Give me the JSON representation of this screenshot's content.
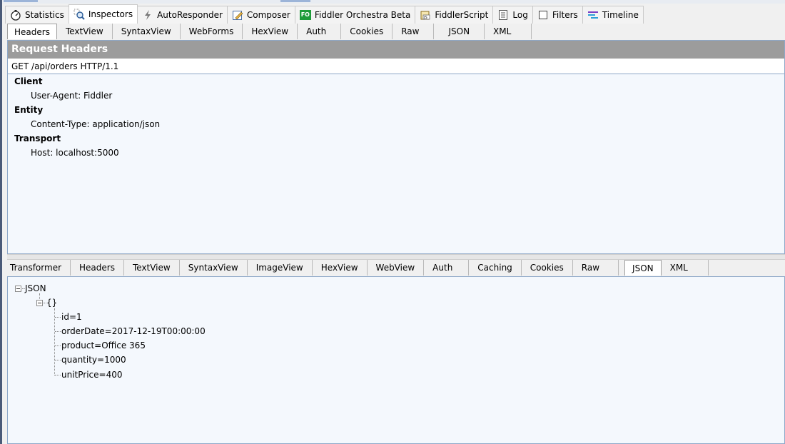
{
  "main_tabs": [
    {
      "label": "Statistics",
      "icon": "stopwatch-icon",
      "active": false
    },
    {
      "label": "Inspectors",
      "icon": "magnifier-icon",
      "active": true
    },
    {
      "label": "AutoResponder",
      "icon": "lightning-icon",
      "active": false
    },
    {
      "label": "Composer",
      "icon": "pencil-icon",
      "active": false
    },
    {
      "label": "Fiddler Orchestra Beta",
      "icon": "fo-icon",
      "badge": "FO",
      "active": false
    },
    {
      "label": "FiddlerScript",
      "icon": "script-icon",
      "active": false
    },
    {
      "label": "Log",
      "icon": "log-icon",
      "active": false
    },
    {
      "label": "Filters",
      "icon": "checkbox-icon",
      "active": false
    },
    {
      "label": "Timeline",
      "icon": "timeline-icon",
      "active": false
    }
  ],
  "request": {
    "subtabs": [
      "Headers",
      "TextView",
      "SyntaxView",
      "WebForms",
      "HexView",
      "Auth",
      "Cookies",
      "Raw",
      "JSON",
      "XML"
    ],
    "active_subtab": "Headers",
    "title": "Request Headers",
    "request_line": "GET /api/orders HTTP/1.1",
    "groups": [
      {
        "name": "Client",
        "items": [
          "User-Agent: Fiddler"
        ]
      },
      {
        "name": "Entity",
        "items": [
          "Content-Type: application/json"
        ]
      },
      {
        "name": "Transport",
        "items": [
          "Host: localhost:5000"
        ]
      }
    ]
  },
  "response": {
    "subtabs": [
      "Transformer",
      "Headers",
      "TextView",
      "SyntaxView",
      "ImageView",
      "HexView",
      "WebView",
      "Auth",
      "Caching",
      "Cookies",
      "Raw",
      "JSON",
      "XML"
    ],
    "active_subtab": "JSON",
    "tree": {
      "root": "JSON",
      "object": "{}",
      "fields": [
        "id=1",
        "orderDate=2017-12-19T00:00:00",
        "product=Office 365",
        "quantity=1000",
        "unitPrice=400"
      ]
    }
  }
}
